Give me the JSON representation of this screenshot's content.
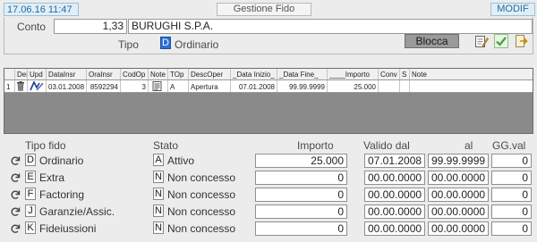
{
  "header": {
    "timestamp": "17.06.16 11:47",
    "title": "Gestione Fido",
    "mode": "MODIF",
    "conto_label": "Conto",
    "conto_code": "1,33",
    "conto_name": "BURUGHI S.P.A.",
    "tipo_label": "Tipo",
    "tipo_code": "D",
    "tipo_value": "Ordinario",
    "blocca_label": "Blocca"
  },
  "toolbar": {
    "icons": [
      "edit-note-icon",
      "check-icon",
      "exit-icon"
    ]
  },
  "grid": {
    "columns": [
      "Del",
      "Upd",
      "DataInsr",
      "OraInsr",
      "CodOp",
      "Note",
      "TOp",
      "DescOper",
      "_Data Inizio_",
      "_Data Fine_",
      "____Importo",
      "Conv",
      "S",
      "Note"
    ],
    "rows": [
      {
        "num": "1",
        "data_insr": "03.01.2008",
        "ora_insr": "8592294",
        "cod_op": "3",
        "top": "A",
        "desc_oper": "Apertura",
        "data_inizio": "07.01.2008",
        "data_fine": "99.99.9999",
        "importo": "25.000",
        "conv": "",
        "s": "",
        "note": ""
      }
    ]
  },
  "fidi": {
    "headers": {
      "tipo": "Tipo fido",
      "stato": "Stato",
      "importo": "Importo",
      "valido_dal": "Valido dal",
      "al": "al",
      "gg_val": "GG.val"
    },
    "rows": [
      {
        "code": "D",
        "tipo": "Ordinario",
        "stato_code": "A",
        "stato": "Attivo",
        "importo": "25.000",
        "dal": "07.01.2008",
        "al": "99.99.9999",
        "gg": "0"
      },
      {
        "code": "E",
        "tipo": "Extra",
        "stato_code": "N",
        "stato": "Non concesso",
        "importo": "0",
        "dal": "00.00.0000",
        "al": "00.00.0000",
        "gg": "0"
      },
      {
        "code": "F",
        "tipo": "Factoring",
        "stato_code": "N",
        "stato": "Non concesso",
        "importo": "0",
        "dal": "00.00.0000",
        "al": "00.00.0000",
        "gg": "0"
      },
      {
        "code": "J",
        "tipo": "Garanzie/Assic.",
        "stato_code": "N",
        "stato": "Non concesso",
        "importo": "0",
        "dal": "00.00.0000",
        "al": "00.00.0000",
        "gg": "0"
      },
      {
        "code": "K",
        "tipo": "Fideiussioni",
        "stato_code": "N",
        "stato": "Non concesso",
        "importo": "0",
        "dal": "00.00.0000",
        "al": "00.00.0000",
        "gg": "0"
      }
    ]
  },
  "colors": {
    "accent_blue": "#2a6fd6",
    "grid_background": "#8a8a8a",
    "check_green": "#3da23d"
  }
}
